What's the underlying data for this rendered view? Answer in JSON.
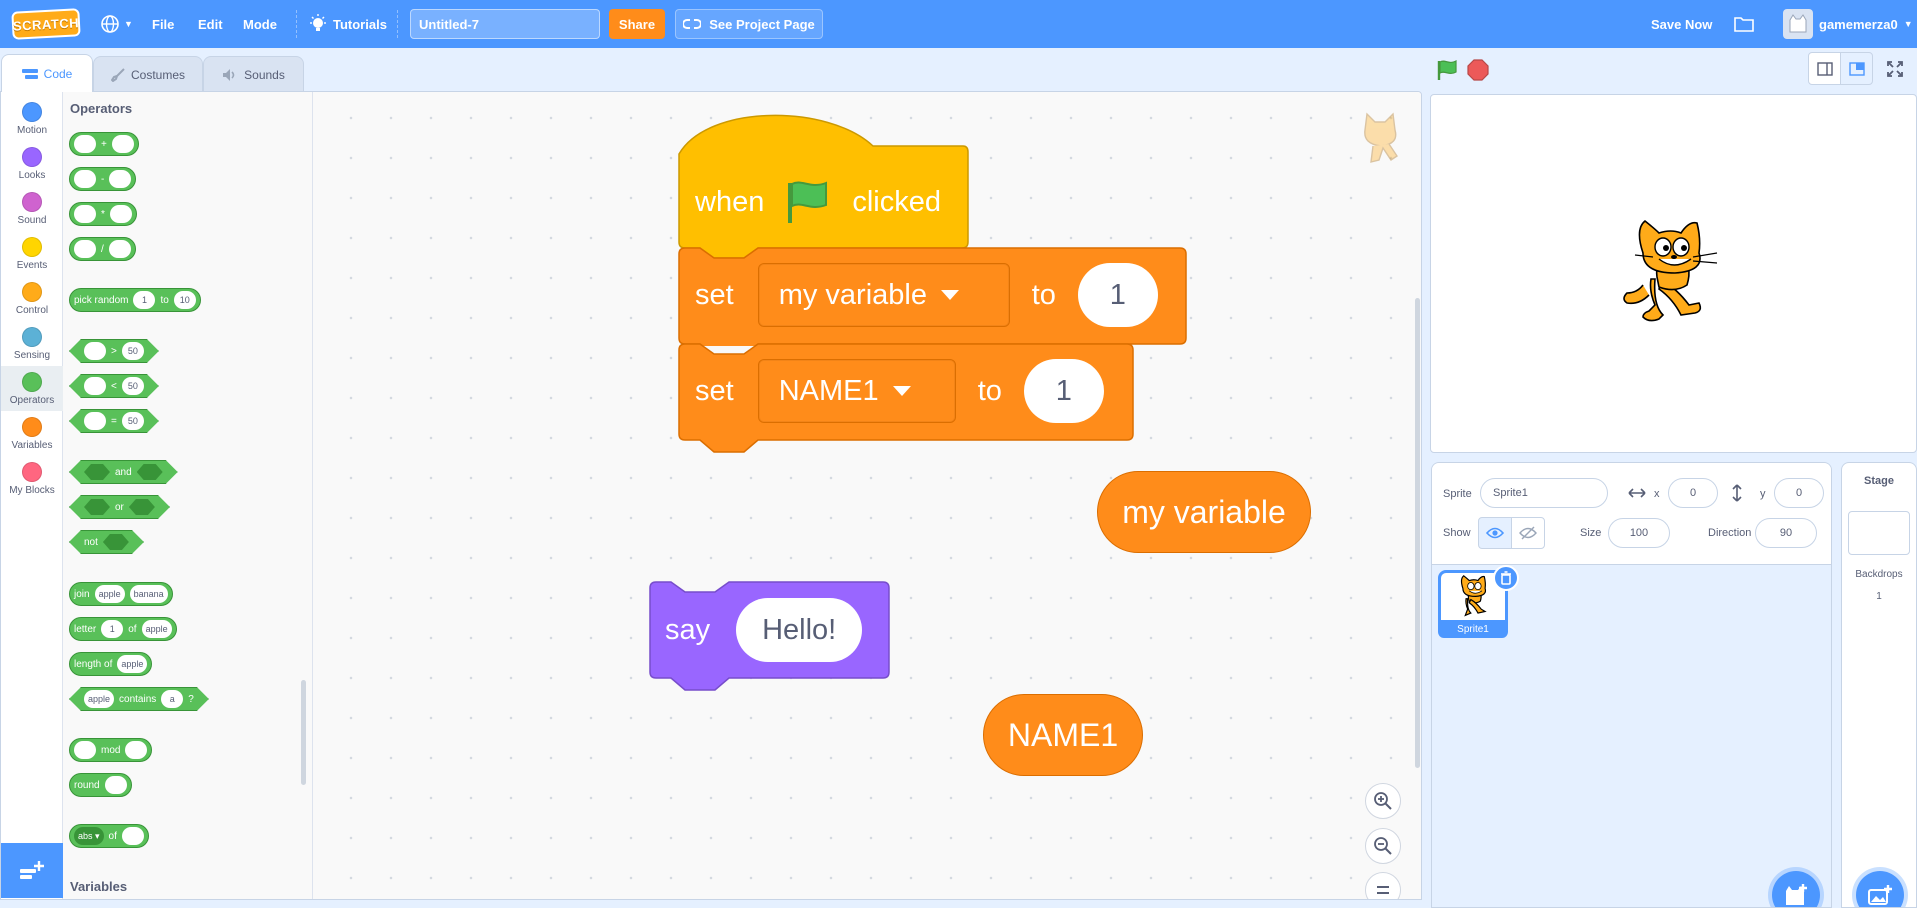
{
  "menubar": {
    "logo_text": "SCRATCH",
    "file": "File",
    "edit": "Edit",
    "mode": "Mode",
    "tutorials": "Tutorials",
    "project_title": "Untitled-7",
    "share": "Share",
    "see_project_page": "See Project Page",
    "save_now": "Save Now",
    "username": "gamemerza0"
  },
  "tabs": {
    "code": "Code",
    "costumes": "Costumes",
    "sounds": "Sounds"
  },
  "categories": [
    {
      "label": "Motion",
      "color": "#4c97ff"
    },
    {
      "label": "Looks",
      "color": "#9966ff"
    },
    {
      "label": "Sound",
      "color": "#cf63cf"
    },
    {
      "label": "Events",
      "color": "#ffd500"
    },
    {
      "label": "Control",
      "color": "#ffab19"
    },
    {
      "label": "Sensing",
      "color": "#5cb1d6"
    },
    {
      "label": "Operators",
      "color": "#59c059"
    },
    {
      "label": "Variables",
      "color": "#ff8c1a"
    },
    {
      "label": "My Blocks",
      "color": "#ff6680"
    }
  ],
  "palette": {
    "operators_heading": "Operators",
    "variables_heading": "Variables",
    "add": "+",
    "sub": "-",
    "mul": "*",
    "div": "/",
    "pick_random": "pick random",
    "pick_from": "1",
    "to": "to",
    "pick_to": "10",
    "gt": ">",
    "lt": "<",
    "eq": "=",
    "cmp_val": "50",
    "and": "and",
    "or": "or",
    "not": "not",
    "join": "join",
    "apple": "apple",
    "banana": "banana",
    "letter": "letter",
    "letter_n": "1",
    "of": "of",
    "length_of": "length of",
    "contains": "contains",
    "contains_a": "a",
    "question": "?",
    "mod": "mod",
    "round": "round",
    "abs": "abs"
  },
  "script": {
    "when": "when",
    "clicked": "clicked",
    "set": "set",
    "var1": "my variable",
    "var2": "NAME1",
    "to": "to",
    "value1": "1",
    "value2": "1",
    "say": "say",
    "say_text": "Hello!",
    "reporter1": "my variable",
    "reporter2": "NAME1"
  },
  "sprite_info": {
    "sprite_label": "Sprite",
    "sprite_name": "Sprite1",
    "x_label": "x",
    "x_value": "0",
    "y_label": "y",
    "y_value": "0",
    "show_label": "Show",
    "size_label": "Size",
    "size_value": "100",
    "direction_label": "Direction",
    "direction_value": "90"
  },
  "sprites": [
    {
      "name": "Sprite1"
    }
  ],
  "stage_pane": {
    "title": "Stage",
    "backdrops_label": "Backdrops",
    "backdrops_count": "1"
  },
  "colors": {
    "accent": "#4c97ff",
    "operators": "#59c059",
    "variables": "#ff8c1a",
    "events": "#ffbf00",
    "looks": "#9966ff"
  }
}
